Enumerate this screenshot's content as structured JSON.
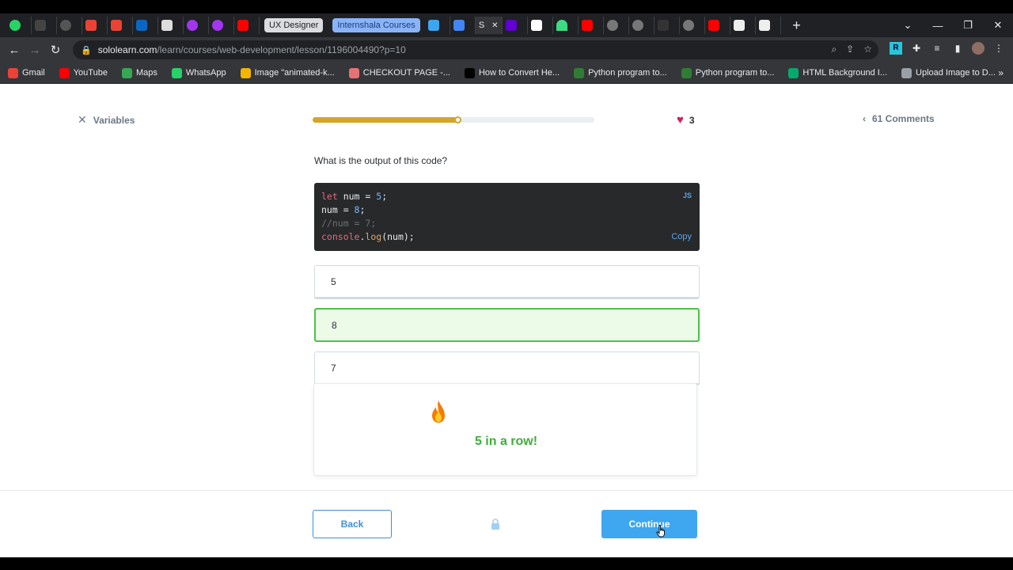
{
  "browser": {
    "tabs_named": [
      "UX Designer",
      "Internshala Courses"
    ],
    "url_host": "sololearn.com",
    "url_path": "/learn/courses/web-development/lesson/1196004490?p=10",
    "bookmarks": [
      {
        "label": "Gmail",
        "icon": "gmail-icon",
        "color": "#ea4335"
      },
      {
        "label": "YouTube",
        "icon": "youtube-icon",
        "color": "#ff0000"
      },
      {
        "label": "Maps",
        "icon": "maps-icon",
        "color": "#34a853"
      },
      {
        "label": "WhatsApp",
        "icon": "whatsapp-icon",
        "color": "#25d366"
      },
      {
        "label": "Image \"animated-k...",
        "icon": "star-icon",
        "color": "#f4b400"
      },
      {
        "label": "CHECKOUT PAGE -...",
        "icon": "checkout-icon",
        "color": "#e57373"
      },
      {
        "label": "How to Convert He...",
        "icon": "alpha-icon",
        "color": "#000000"
      },
      {
        "label": "Python program to...",
        "icon": "python-icon",
        "color": "#2e7d32"
      },
      {
        "label": "Python program to...",
        "icon": "python-icon",
        "color": "#2e7d32"
      },
      {
        "label": "HTML Background I...",
        "icon": "w3-icon",
        "color": "#04aa6d"
      },
      {
        "label": "Upload Image to D...",
        "icon": "globe-icon",
        "color": "#9aa0a6"
      }
    ]
  },
  "lesson": {
    "exit_label": "Variables",
    "progress": 0.52,
    "hearts": "3",
    "comments": "61 Comments",
    "question": "What is the output of this code?",
    "code_lang": "JS",
    "copy_label": "Copy",
    "code": {
      "l1_kw": "let",
      "l1_rest": " num = ",
      "l1_num": "5",
      "l1_end": ";",
      "l2_rest": "num = ",
      "l2_num": "8",
      "l2_end": ";",
      "l3_comment": "//num = 7;",
      "l4_obj": "console",
      "l4_dot": ".",
      "l4_fn": "log",
      "l4_rest": "(num);"
    },
    "options": [
      "5",
      "8",
      "7"
    ],
    "selected_index": 1,
    "streak_text": "5 in a row!",
    "back_label": "Back",
    "continue_label": "Continue"
  },
  "colors": {
    "progress": "#d4a52a",
    "correct": "#4ec04a",
    "primary": "#3fa6f0",
    "heart": "#d81b60"
  }
}
